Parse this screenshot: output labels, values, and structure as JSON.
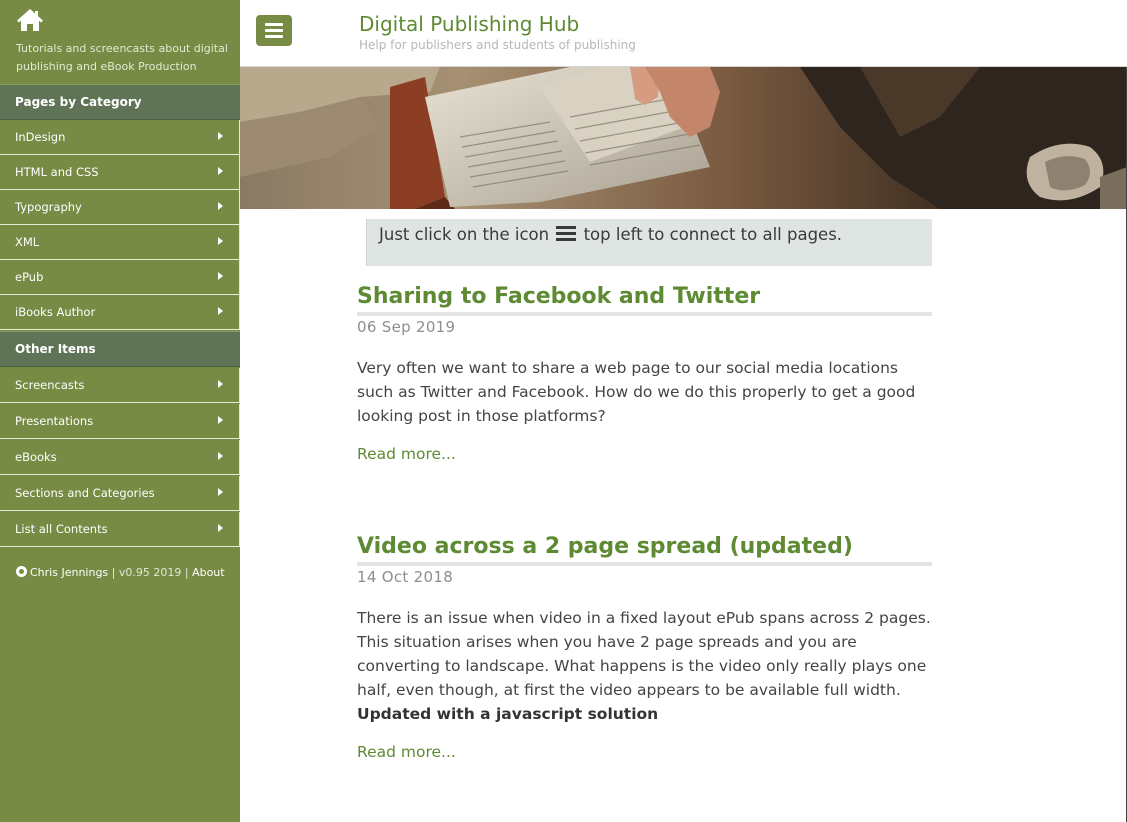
{
  "sidebar": {
    "tagline": "Tutorials and screencasts about digital publishing and eBook Production",
    "section1_header": "Pages by Category",
    "section1_items": [
      {
        "label": "InDesign"
      },
      {
        "label": "HTML and CSS"
      },
      {
        "label": "Typography"
      },
      {
        "label": "XML"
      },
      {
        "label": "ePub"
      },
      {
        "label": "iBooks Author"
      }
    ],
    "section2_header": "Other Items",
    "section2_items": [
      {
        "label": "Screencasts"
      },
      {
        "label": "Presentations"
      },
      {
        "label": "eBooks"
      },
      {
        "label": "Sections and Categories"
      },
      {
        "label": "List all Contents"
      }
    ],
    "footer": {
      "author": "Chris Jennings",
      "separator1": " | ",
      "version": "v0.95 2019",
      "separator2": " | ",
      "about": "About"
    }
  },
  "header": {
    "title": "Digital Publishing Hub",
    "subtitle": "Help for publishers and students of publishing"
  },
  "notice": {
    "text_before": "Just click on the icon ",
    "text_after": " top left to connect to all pages."
  },
  "articles": [
    {
      "title": "Sharing to Facebook and Twitter",
      "date": "06 Sep 2019",
      "body": "Very often we want to share a web page to our social media locations such as Twitter and Facebook. How do we do this properly to get a good looking post in those platforms?",
      "bold": "",
      "read_more": "Read more..."
    },
    {
      "title": "Video across a 2 page spread (updated)",
      "date": "14 Oct 2018",
      "body": "There is an issue when video in a fixed layout ePub spans across 2 pages. This situation arises when you have 2 page spreads and you are converting to landscape. What happens is the video only really plays one half, even though, at first the video appears to be available full width. ",
      "bold": "Updated with a javascript solution",
      "read_more": "Read more..."
    }
  ],
  "colors": {
    "sidebar_bg": "#778b45",
    "sidebar_header_bg": "#5f7357",
    "accent_green": "#5d8a32",
    "notice_bg": "#dfe5e2"
  },
  "icons": {
    "home": "home-icon",
    "menu": "hamburger-menu-icon",
    "copyright": "copyright-icon",
    "submenu": "chevron-right-icon"
  }
}
